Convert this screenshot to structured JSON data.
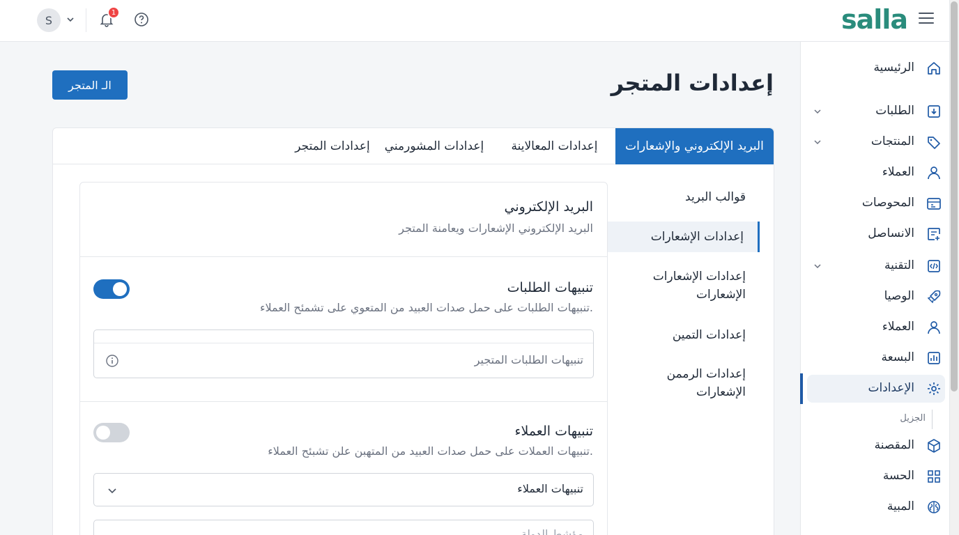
{
  "header": {
    "logo": "salla",
    "avatar_initial": "S",
    "notification_count": "1"
  },
  "page": {
    "title": "إعدادات المتجر",
    "view_store_button": "الـ المتجر"
  },
  "sidebar": {
    "items": [
      {
        "label": "الرئيسية",
        "icon": "home-icon",
        "has_caret": false
      },
      {
        "label": "الطلبات",
        "icon": "download-box-icon",
        "has_caret": true
      },
      {
        "label": "المنتجات",
        "icon": "tag-icon",
        "has_caret": true
      },
      {
        "label": "العملاء",
        "icon": "user-icon",
        "has_caret": false
      },
      {
        "label": "المحوصات",
        "icon": "calendar-icon",
        "has_caret": false
      },
      {
        "label": "الانساصل",
        "icon": "plus-box-icon",
        "has_caret": false
      },
      {
        "label": "التقنية",
        "icon": "code-box-icon",
        "has_caret": true
      },
      {
        "label": "الوصيا",
        "icon": "rocket-icon",
        "has_caret": false
      },
      {
        "label": "العملاء",
        "icon": "user-icon",
        "has_caret": false
      },
      {
        "label": "البسعة",
        "icon": "chart-box-icon",
        "has_caret": false
      },
      {
        "label": "الإعدادات",
        "icon": "gear-icon",
        "has_caret": false,
        "active": true
      },
      {
        "label": "المقصنة",
        "icon": "cube-icon",
        "has_caret": false
      },
      {
        "label": "الحسة",
        "icon": "grid-icon",
        "has_caret": false
      },
      {
        "label": "المبية",
        "icon": "brain-icon",
        "has_caret": false
      }
    ],
    "sub_label": "الجزيل"
  },
  "tabs": [
    {
      "label": "البريد الإلكتروني والإشعارات",
      "active": true
    },
    {
      "label": "إعدادات المعالاينة",
      "active": false
    },
    {
      "label": "إعدادات المشورمني",
      "active": false
    },
    {
      "label": "إعدادات المتجر",
      "active": false
    }
  ],
  "subnav": [
    {
      "label": "قوالب البريد",
      "active": false
    },
    {
      "label": "إعدادات الإشعارات",
      "active": true
    },
    {
      "label": "إعدادات الإشعارات\nالإشعارات",
      "active": false
    },
    {
      "label": "إعدادات التمين",
      "active": false
    },
    {
      "label": "إعدادات الرممن\nالإشعارات",
      "active": false
    }
  ],
  "panel": {
    "title": "البريد الإلكتروني",
    "description": "البريد الإلكتروني الإشعارات ويعامنة المتجر",
    "order_alerts": {
      "title": "تنبيهات الطلبات",
      "description": "تنبيهات الطلبات على حمل صدات العبيد من المتعوي على تشمئح العملاء.",
      "enabled": true,
      "input_placeholder": "تنبيهات الطلبات المتجير"
    },
    "customer_alerts": {
      "title": "تنبيهات العملاء",
      "description": "تنبيهات العملات على حمل صدات العبيد من المتهبن علن تشبئح العملاء.",
      "enabled": false,
      "select_value": "تنبيهات العملاء",
      "next_input_placeholder": "مؤشط الدولة"
    }
  },
  "colors": {
    "brand": "#2a8c7c",
    "primary": "#1f6fbf",
    "badge": "#ef4444"
  }
}
